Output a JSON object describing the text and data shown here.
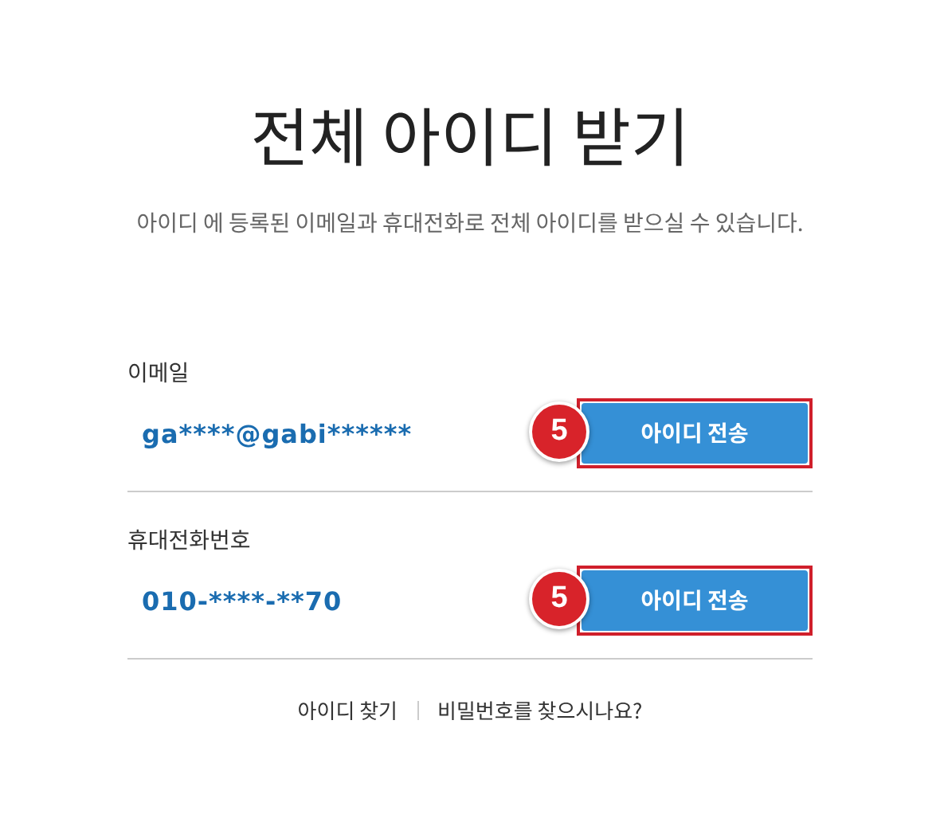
{
  "title": "전체 아이디 받기",
  "subtitle": "아이디 에 등록된 이메일과 휴대전화로 전체 아이디를 받으실 수 있습니다.",
  "sections": [
    {
      "label": "이메일",
      "value": "ga****@gabi******",
      "button": "아이디 전송",
      "badge": "5"
    },
    {
      "label": "휴대전화번호",
      "value": "010-****-**70",
      "button": "아이디 전송",
      "badge": "5"
    }
  ],
  "footer_links": [
    "아이디 찾기",
    "비밀번호를 찾으시나요?"
  ]
}
